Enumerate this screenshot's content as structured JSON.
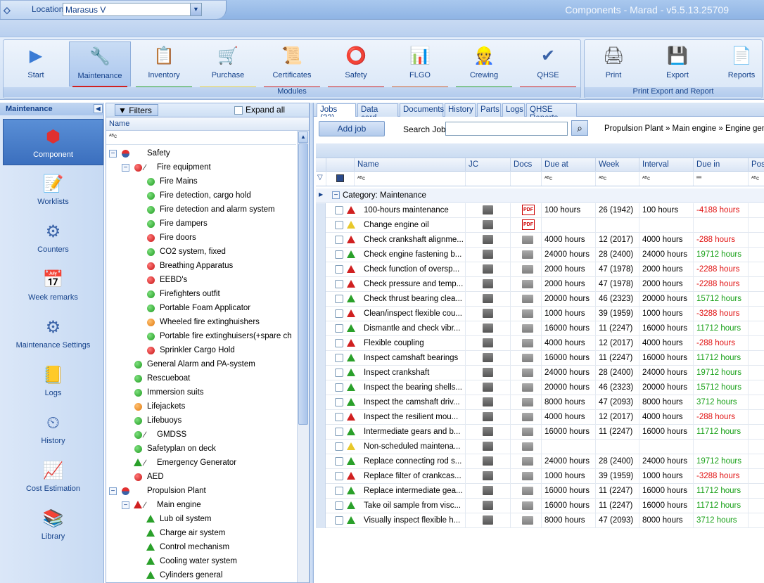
{
  "window": {
    "title": "Components - Marad - v5.5.13.25709"
  },
  "location": {
    "label": "Location",
    "value": "Marasus V"
  },
  "ribbon": {
    "modules": [
      {
        "label": "Start",
        "icon": "play-icon",
        "color": ""
      },
      {
        "label": "Maintenance",
        "icon": "maintenance-icon",
        "color": "#d02020"
      },
      {
        "label": "Inventory",
        "icon": "inventory-icon",
        "color": "#2aa02a"
      },
      {
        "label": "Purchase",
        "icon": "cart-icon",
        "color": "#e8d040"
      },
      {
        "label": "Certificates",
        "icon": "certificate-icon",
        "color": "#d02020"
      },
      {
        "label": "Safety",
        "icon": "lifebuoy-icon",
        "color": "#d02020"
      },
      {
        "label": "FLGO",
        "icon": "bar-chart-icon",
        "color": "#d06030"
      },
      {
        "label": "Crewing",
        "icon": "crew-icon",
        "color": "#2aa02a"
      },
      {
        "label": "QHSE",
        "icon": "qhse-icon",
        "color": "#d02020"
      }
    ],
    "modules_label": "Modules",
    "exports": [
      {
        "label": "Print",
        "icon": "printer-icon"
      },
      {
        "label": "Export",
        "icon": "export-icon"
      },
      {
        "label": "Reports",
        "icon": "report-icon"
      }
    ],
    "exports_label": "Print Export and Report"
  },
  "nav": {
    "title": "Maintenance",
    "items": [
      {
        "label": "Component",
        "icon": "component-icon"
      },
      {
        "label": "Worklists",
        "icon": "worklist-icon"
      },
      {
        "label": "Counters",
        "icon": "counter-gear-icon"
      },
      {
        "label": "Week remarks",
        "icon": "calendar-icon"
      },
      {
        "label": "Maintenance Settings",
        "icon": "settings-gear-icon"
      },
      {
        "label": "Logs",
        "icon": "log-icon"
      },
      {
        "label": "History",
        "icon": "history-clock-icon"
      },
      {
        "label": "Cost Estimation",
        "icon": "cost-icon"
      },
      {
        "label": "Library",
        "icon": "library-icon"
      }
    ]
  },
  "tree": {
    "filters_label": "Filters",
    "expand_all_label": "Expand all",
    "name_header": "Name",
    "filter_placeholder": "ᴬᴮc",
    "nodes": [
      {
        "text": "Safety",
        "level": 0,
        "status": "halfred",
        "expand": "−"
      },
      {
        "text": "Fire equipment",
        "level": 1,
        "status": "red",
        "expand": "−",
        "slash": true
      },
      {
        "text": "Fire Mains",
        "level": 2,
        "status": "green"
      },
      {
        "text": "Fire detection, cargo hold",
        "level": 2,
        "status": "green"
      },
      {
        "text": "Fire detection and alarm system",
        "level": 2,
        "status": "green"
      },
      {
        "text": "Fire dampers",
        "level": 2,
        "status": "green"
      },
      {
        "text": "Fire doors",
        "level": 2,
        "status": "red"
      },
      {
        "text": "CO2 system, fixed",
        "level": 2,
        "status": "green"
      },
      {
        "text": "Breathing Apparatus",
        "level": 2,
        "status": "red"
      },
      {
        "text": "EEBD's",
        "level": 2,
        "status": "red"
      },
      {
        "text": "Firefighters outfit",
        "level": 2,
        "status": "green"
      },
      {
        "text": "Portable Foam Applicator",
        "level": 2,
        "status": "green"
      },
      {
        "text": "Wheeled fire extinghuishers",
        "level": 2,
        "status": "orange"
      },
      {
        "text": "Portable fire extinghuisers(+spare ch",
        "level": 2,
        "status": "green"
      },
      {
        "text": "Sprinkler Cargo Hold",
        "level": 2,
        "status": "red"
      },
      {
        "text": "General Alarm and PA-system",
        "level": 1,
        "status": "green"
      },
      {
        "text": "Rescueboat",
        "level": 1,
        "status": "green"
      },
      {
        "text": "Immersion suits",
        "level": 1,
        "status": "green"
      },
      {
        "text": "Lifejackets",
        "level": 1,
        "status": "orange"
      },
      {
        "text": "Lifebuoys",
        "level": 1,
        "status": "green"
      },
      {
        "text": "GMDSS",
        "level": 1,
        "status": "green",
        "slash": true
      },
      {
        "text": "Safetyplan on deck",
        "level": 1,
        "status": "green"
      },
      {
        "text": "Emergency Generator",
        "level": 1,
        "status": "tri-g",
        "slash": true
      },
      {
        "text": "AED",
        "level": 1,
        "status": "red"
      },
      {
        "text": "Propulsion Plant",
        "level": 0,
        "status": "halfred",
        "expand": "−"
      },
      {
        "text": "Main engine",
        "level": 1,
        "status": "tri-r",
        "expand": "−",
        "slash": true
      },
      {
        "text": "Lub oil system",
        "level": 2,
        "status": "tri-g"
      },
      {
        "text": "Charge air system",
        "level": 2,
        "status": "tri-g"
      },
      {
        "text": "Control mechanism",
        "level": 2,
        "status": "tri-g"
      },
      {
        "text": "Cooling water system",
        "level": 2,
        "status": "tri-g"
      },
      {
        "text": "Cylinders general",
        "level": 2,
        "status": "tri-g"
      }
    ]
  },
  "tabs": [
    "Jobs (22)",
    "Data card",
    "Documents",
    "History",
    "Parts",
    "Logs",
    "QHSE Reports"
  ],
  "jobbar": {
    "add_job": "Add job",
    "search_label": "Search Job",
    "search_value": "",
    "breadcrumb": "Propulsion Plant  »  Main engine  »  Engine gene"
  },
  "grid": {
    "headers": [
      "Name",
      "JC",
      "Docs",
      "Due at",
      "Week",
      "Interval",
      "Due in",
      "Pos"
    ],
    "filter_placeholder": "ᴬᴮc",
    "category": "Category: Maintenance",
    "rows": [
      {
        "status": "r",
        "name": "100-hours maintenance",
        "pdf": true,
        "due": "100 hours",
        "week": "26 (1942)",
        "interval": "100 hours",
        "duein": "-4188 hours"
      },
      {
        "status": "y",
        "name": "Change engine oil",
        "pdf": true,
        "due": "",
        "week": "",
        "interval": "",
        "duein": ""
      },
      {
        "status": "r",
        "name": "Check crankshaft alignme...",
        "pdf": false,
        "due": "4000 hours",
        "week": "12 (2017)",
        "interval": "4000 hours",
        "duein": "-288 hours"
      },
      {
        "status": "g",
        "name": "Check engine fastening b...",
        "pdf": false,
        "due": "24000 hours",
        "week": "28 (2400)",
        "interval": "24000 hours",
        "duein": "19712 hours"
      },
      {
        "status": "r",
        "name": "Check function of oversp...",
        "pdf": false,
        "due": "2000 hours",
        "week": "47 (1978)",
        "interval": "2000 hours",
        "duein": "-2288 hours"
      },
      {
        "status": "r",
        "name": "Check pressure and temp...",
        "pdf": false,
        "due": "2000 hours",
        "week": "47 (1978)",
        "interval": "2000 hours",
        "duein": "-2288 hours"
      },
      {
        "status": "g",
        "name": "Check thrust bearing clea...",
        "pdf": false,
        "due": "20000 hours",
        "week": "46 (2323)",
        "interval": "20000 hours",
        "duein": "15712 hours"
      },
      {
        "status": "r",
        "name": "Clean/inspect flexible cou...",
        "pdf": false,
        "due": "1000 hours",
        "week": "39 (1959)",
        "interval": "1000 hours",
        "duein": "-3288 hours"
      },
      {
        "status": "g",
        "name": "Dismantle and check vibr...",
        "pdf": false,
        "due": "16000 hours",
        "week": "11 (2247)",
        "interval": "16000 hours",
        "duein": "11712 hours"
      },
      {
        "status": "r",
        "name": "Flexible coupling",
        "pdf": false,
        "due": "4000 hours",
        "week": "12 (2017)",
        "interval": "4000 hours",
        "duein": "-288 hours"
      },
      {
        "status": "g",
        "name": "Inspect camshaft bearings",
        "pdf": false,
        "due": "16000 hours",
        "week": "11 (2247)",
        "interval": "16000 hours",
        "duein": "11712 hours"
      },
      {
        "status": "g",
        "name": "Inspect crankshaft",
        "pdf": false,
        "due": "24000 hours",
        "week": "28 (2400)",
        "interval": "24000 hours",
        "duein": "19712 hours"
      },
      {
        "status": "g",
        "name": "Inspect the bearing shells...",
        "pdf": false,
        "due": "20000 hours",
        "week": "46 (2323)",
        "interval": "20000 hours",
        "duein": "15712 hours"
      },
      {
        "status": "g",
        "name": "Inspect the camshaft driv...",
        "pdf": false,
        "due": "8000 hours",
        "week": "47 (2093)",
        "interval": "8000 hours",
        "duein": "3712 hours"
      },
      {
        "status": "r",
        "name": "Inspect the resilient mou...",
        "pdf": false,
        "due": "4000 hours",
        "week": "12 (2017)",
        "interval": "4000 hours",
        "duein": "-288 hours"
      },
      {
        "status": "g",
        "name": "Intermediate gears and b...",
        "pdf": false,
        "due": "16000 hours",
        "week": "11 (2247)",
        "interval": "16000 hours",
        "duein": "11712 hours"
      },
      {
        "status": "y",
        "name": "Non-scheduled maintena...",
        "pdf": false,
        "due": "",
        "week": "",
        "interval": "",
        "duein": ""
      },
      {
        "status": "g",
        "name": "Replace connecting rod s...",
        "pdf": false,
        "due": "24000 hours",
        "week": "28 (2400)",
        "interval": "24000 hours",
        "duein": "19712 hours"
      },
      {
        "status": "r",
        "name": "Replace filter of crankcas...",
        "pdf": false,
        "due": "1000 hours",
        "week": "39 (1959)",
        "interval": "1000 hours",
        "duein": "-3288 hours"
      },
      {
        "status": "g",
        "name": "Replace intermediate gea...",
        "pdf": false,
        "due": "16000 hours",
        "week": "11 (2247)",
        "interval": "16000 hours",
        "duein": "11712 hours"
      },
      {
        "status": "g",
        "name": "Take oil sample from visc...",
        "pdf": false,
        "due": "16000 hours",
        "week": "11 (2247)",
        "interval": "16000 hours",
        "duein": "11712 hours"
      },
      {
        "status": "g",
        "name": "Visually inspect flexible h...",
        "pdf": false,
        "due": "8000 hours",
        "week": "47 (2093)",
        "interval": "8000 hours",
        "duein": "3712 hours"
      }
    ]
  }
}
